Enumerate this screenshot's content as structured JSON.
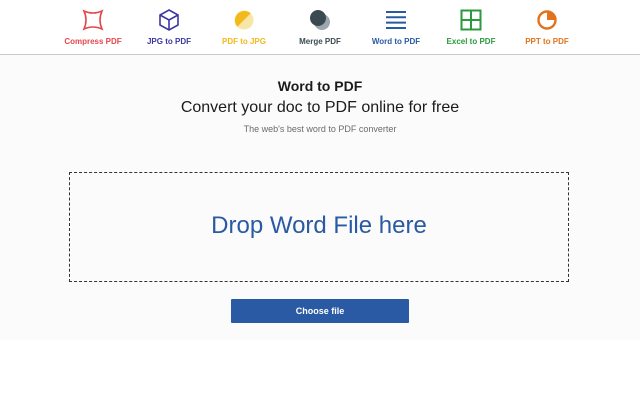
{
  "nav": {
    "items": [
      {
        "label": "Compress PDF",
        "icon": "compress-icon",
        "color": "#e2474b"
      },
      {
        "label": "JPG to PDF",
        "icon": "cube-icon",
        "color": "#3a38a0"
      },
      {
        "label": "PDF to JPG",
        "icon": "half-circle-icon",
        "color": "#f2b91c"
      },
      {
        "label": "Merge PDF",
        "icon": "merge-icon",
        "color": "#3b4a52"
      },
      {
        "label": "Word to PDF",
        "icon": "lines-icon",
        "color": "#2a5aa3"
      },
      {
        "label": "Excel to PDF",
        "icon": "grid-icon",
        "color": "#2b9a3d"
      },
      {
        "label": "PPT to PDF",
        "icon": "pie-icon",
        "color": "#e2731c"
      }
    ]
  },
  "main": {
    "title": "Word to PDF",
    "subtitle": "Convert your doc to PDF online for free",
    "tagline": "The web's best word to PDF converter",
    "drop_label": "Drop Word File here",
    "choose_label": "Choose file"
  },
  "colors": {
    "accent": "#2a5aa3",
    "background": "#fbfbfb"
  }
}
